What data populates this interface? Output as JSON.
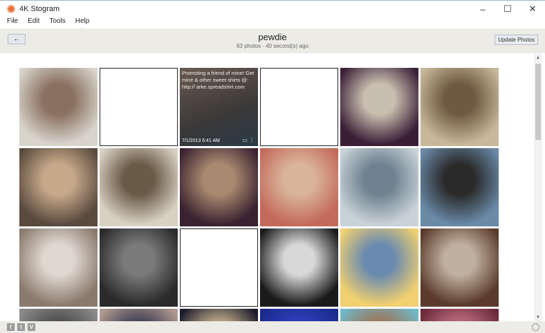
{
  "app": {
    "title": "4K Stogram"
  },
  "window": {
    "minimize": "–",
    "maximize": "☐",
    "close": "✕"
  },
  "menu": [
    "File",
    "Edit",
    "Tools",
    "Help"
  ],
  "header": {
    "back": "←",
    "title": "pewdie",
    "subtitle": "63 photos · 40 second(s) ago",
    "update": "Update Photos"
  },
  "hover_tile": {
    "caption": "Promoting a friend of mine! Get mine & other sweet shirts @: http:// arke.spreadshirt.com",
    "date": "7/1/2013 6:41 AM",
    "icons": "▭ ⋮"
  },
  "tiles": [
    [
      "#d8d4cc",
      "#8a7060"
    ],
    [
      "blank"
    ],
    [
      "hover"
    ],
    [
      "blank"
    ],
    [
      "#3a1e36",
      "#c9bfb0"
    ],
    [
      "#c8b89a",
      "#6e5a40"
    ],
    [
      "#5a4a3e",
      "#c7a98a"
    ],
    [
      "#d9d2c4",
      "#6a5a48"
    ],
    [
      "#3a2230",
      "#a98a70"
    ],
    [
      "#c46a5a",
      "#d9b49a"
    ],
    [
      "#c9d2d8",
      "#6f8290"
    ],
    [
      "#6a8aa8",
      "#2a2a2a"
    ],
    [
      "#8a7a6e",
      "#e0d8d0"
    ],
    [
      "#2a2a2a",
      "#7a7a7a"
    ],
    [
      "blank"
    ],
    [
      "#1a1a1a",
      "#d8d8d8"
    ],
    [
      "#f0d070",
      "#6a8ab0"
    ],
    [
      "#5a3a2a",
      "#c0b0a0"
    ],
    [
      "#8a8a8a",
      "#4a4a4a"
    ],
    [
      "#b09a90",
      "#3a3a50"
    ],
    [
      "#1a1a2a",
      "#c9b490"
    ],
    [
      "#1a2a8a",
      "#3040c0"
    ],
    [
      "#70b8c8",
      "#a07050"
    ],
    [
      "#6a2a3a",
      "#c07080"
    ]
  ],
  "footer": {
    "facebook": "f",
    "twitter": "t",
    "vimeo": "V"
  }
}
